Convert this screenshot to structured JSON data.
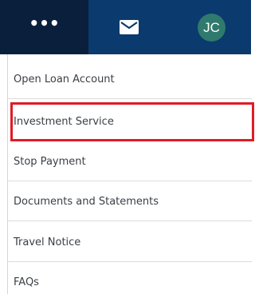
{
  "header": {
    "more_label": "•••",
    "avatar_initials": "JC",
    "colors": {
      "bar": "#0b3a6e",
      "more_button": "#0a1f3c",
      "avatar": "#2f7a6c",
      "highlight": "#e01b24"
    },
    "icons": {
      "more": "more-dots-icon",
      "mail": "mail-icon"
    }
  },
  "menu": {
    "items": [
      {
        "label": "Open Loan Account"
      },
      {
        "label": "Investment Service",
        "highlighted": true
      },
      {
        "label": "Stop Payment"
      },
      {
        "label": "Documents and Statements"
      },
      {
        "label": "Travel Notice"
      },
      {
        "label": "FAQs"
      }
    ]
  }
}
